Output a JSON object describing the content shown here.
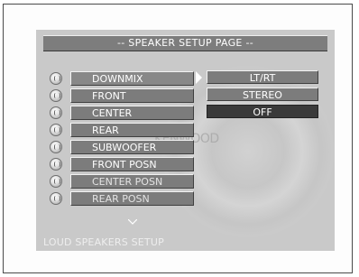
{
  "page_title": "-- SPEAKER SETUP PAGE --",
  "brand_watermark": "KENWOOD",
  "menu": {
    "items": [
      {
        "label": "DOWNMIX",
        "icon": "speaker-icon"
      },
      {
        "label": "FRONT",
        "icon": "speaker-icon"
      },
      {
        "label": "CENTER",
        "icon": "speaker-icon"
      },
      {
        "label": "REAR",
        "icon": "speaker-icon"
      },
      {
        "label": "SUBWOOFER",
        "icon": "speaker-icon"
      },
      {
        "label": "FRONT POSN",
        "icon": "speaker-icon"
      },
      {
        "label": "CENTER POSN",
        "icon": "speaker-icon"
      },
      {
        "label": "REAR POSN",
        "icon": "speaker-icon"
      }
    ],
    "selected": "DOWNMIX"
  },
  "submenu": {
    "options": [
      "LT/RT",
      "STEREO",
      "OFF"
    ],
    "current": "OFF"
  },
  "footer_text": "LOUD SPEAKERS SETUP",
  "colors": {
    "panel": "#c9c9c9",
    "item": "#7c7c7c",
    "highlight": "#3a3a3a",
    "text": "#ffffff"
  }
}
